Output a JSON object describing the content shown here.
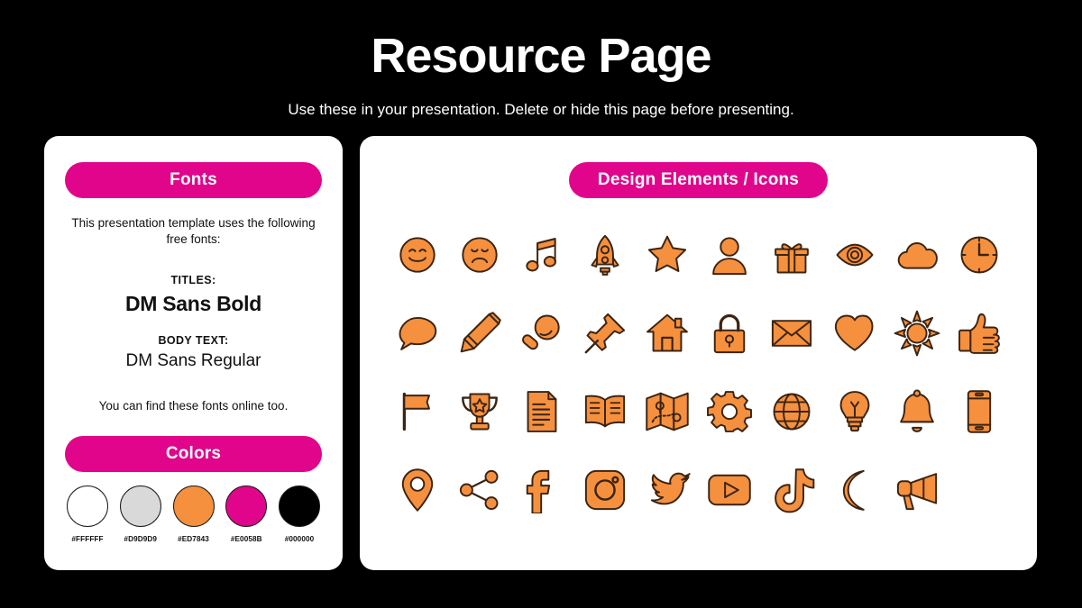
{
  "header": {
    "title": "Resource Page",
    "subtitle": "Use these in your presentation. Delete or hide this page before presenting."
  },
  "left_panel": {
    "fonts_heading": "Fonts",
    "intro_line": "This presentation template uses the following free fonts:",
    "titles_label": "TITLES:",
    "titles_value": "DM Sans Bold",
    "body_label": "BODY TEXT:",
    "body_value": "DM Sans Regular",
    "note": "You can find these fonts online too.",
    "colors_heading": "Colors",
    "swatches": [
      {
        "hex": "#FFFFFF",
        "fill": "#FFFFFF"
      },
      {
        "hex": "#D9D9D9",
        "fill": "#D9D9D9"
      },
      {
        "hex": "#ED7843",
        "fill": "#F5903E"
      },
      {
        "hex": "#E0058B",
        "fill": "#E0058B"
      },
      {
        "hex": "#000000",
        "fill": "#000000"
      }
    ]
  },
  "right_panel": {
    "icons_heading": "Design Elements / Icons",
    "icon_fill": "#F5903E",
    "icon_stroke": "#3B2412",
    "icons": [
      "smiley-face-icon",
      "sad-face-icon",
      "music-note-icon",
      "rocket-icon",
      "star-icon",
      "person-icon",
      "gift-icon",
      "eye-icon",
      "cloud-icon",
      "clock-icon",
      "speech-bubble-icon",
      "pencil-icon",
      "magnifying-glass-icon",
      "pushpin-icon",
      "house-icon",
      "lock-icon",
      "envelope-icon",
      "heart-icon",
      "sun-icon",
      "thumbs-up-icon",
      "flag-icon",
      "trophy-icon",
      "document-icon",
      "book-icon",
      "map-icon",
      "gear-icon",
      "globe-icon",
      "lightbulb-icon",
      "bell-icon",
      "smartphone-icon",
      "location-pin-icon",
      "share-icon",
      "facebook-icon",
      "instagram-icon",
      "twitter-icon",
      "youtube-icon",
      "tiktok-icon",
      "moon-icon",
      "megaphone-icon"
    ]
  }
}
